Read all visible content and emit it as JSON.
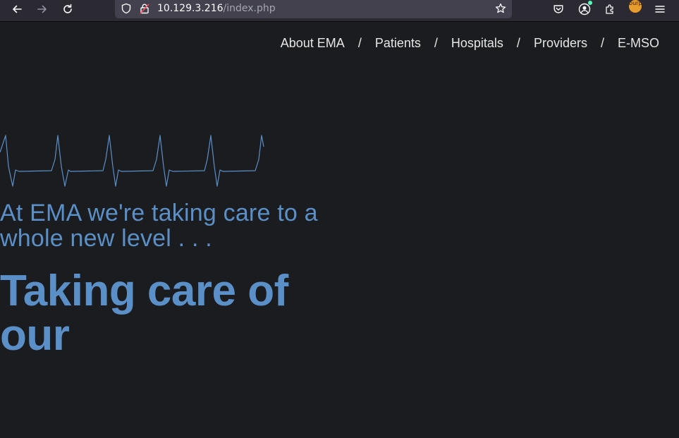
{
  "browser": {
    "url_host": "10.129.3.216",
    "url_path": "/index.php",
    "extension_badge": "burp"
  },
  "nav": {
    "items": [
      "About EMA",
      "Patients",
      "Hospitals",
      "Providers",
      "E-MSO"
    ],
    "separator": "/"
  },
  "hero": {
    "tagline": "At EMA we're taking care to a whole new level . . .",
    "headline": "Taking care of our"
  },
  "colors": {
    "background": "#1b1c1f",
    "accent": "#5b8fc7",
    "nav_text": "#e6e6e6"
  }
}
